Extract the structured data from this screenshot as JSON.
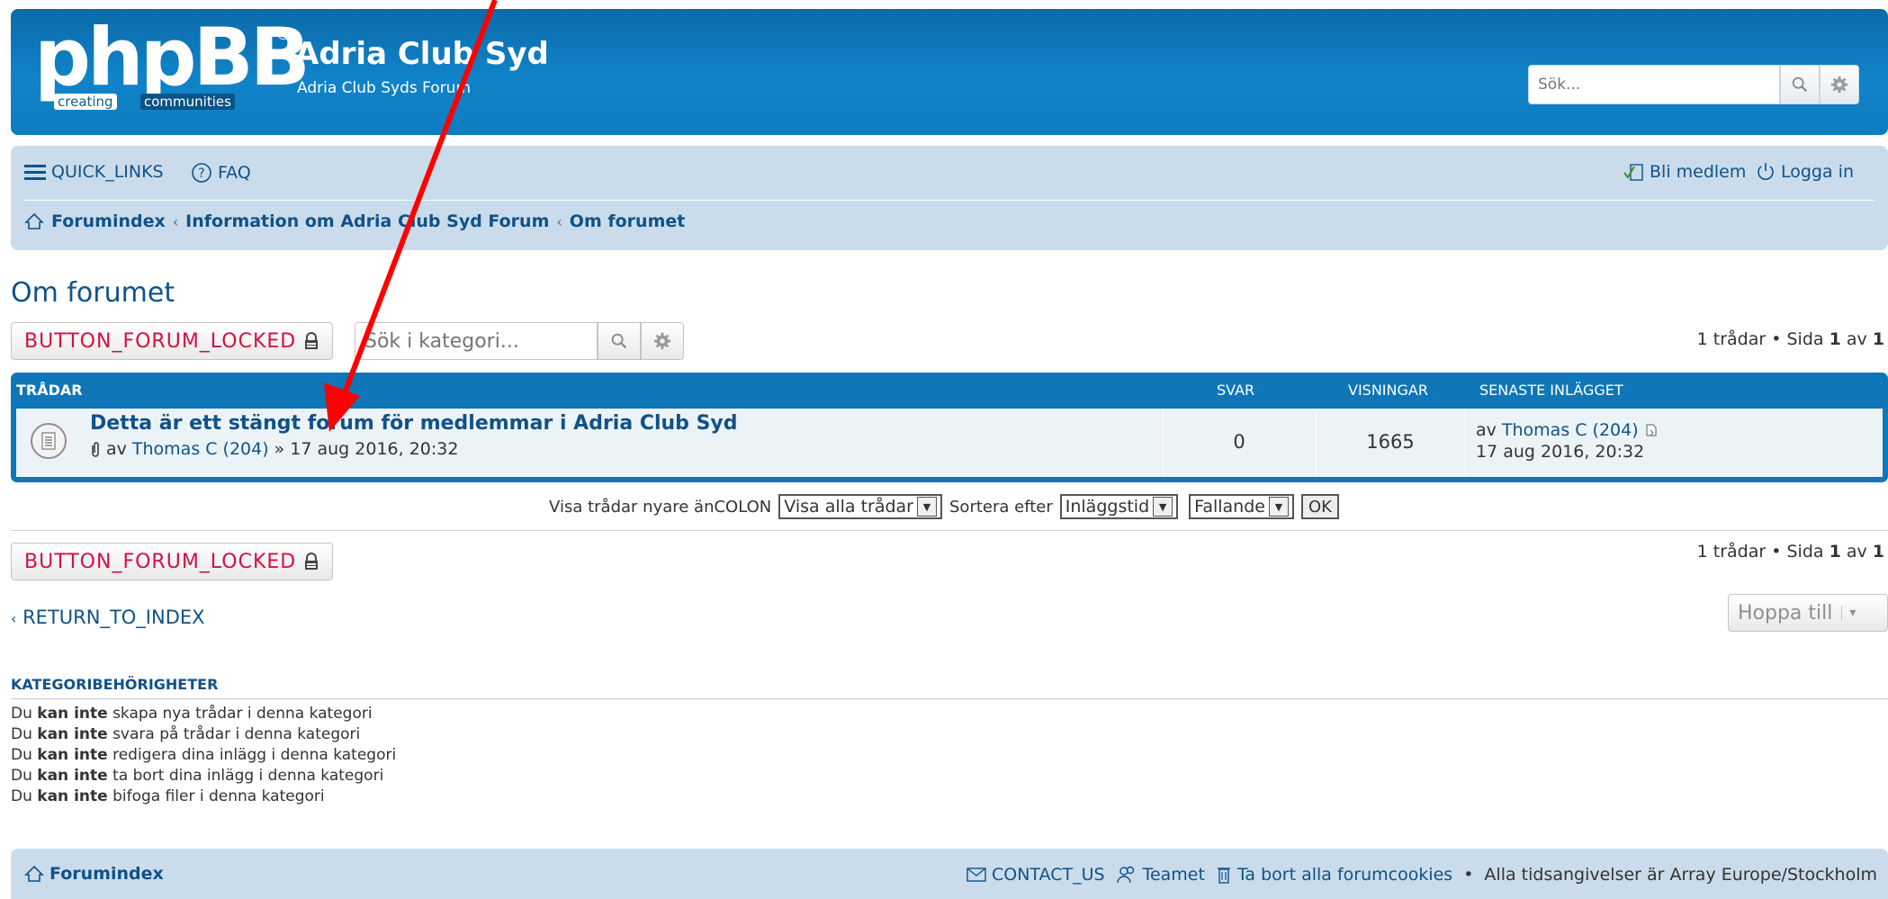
{
  "header": {
    "logo_word": "phpBB",
    "logo_registered": "®",
    "logo_tagline_1": "creating",
    "logo_tagline_2": "communities",
    "site_title": "Adria Club Syd",
    "site_description": "Adria Club Syds Forum",
    "search_placeholder": "Sök..."
  },
  "navbar": {
    "quick_links": "QUICK_LINKS",
    "faq": "FAQ",
    "register": "Bli medlem",
    "login": "Logga in",
    "breadcrumbs": [
      "Forumindex",
      "Information om Adria Club Syd Forum",
      "Om forumet"
    ]
  },
  "forum": {
    "title": "Om forumet",
    "locked_button": "BUTTON_FORUM_LOCKED",
    "category_search_placeholder": "Sök i kategori...",
    "pagination": {
      "prefix": "1 trådar • Sida ",
      "current": "1",
      "middle": " av ",
      "total": "1"
    }
  },
  "topics_table": {
    "headers": {
      "topics": "TRÅDAR",
      "replies": "SVAR",
      "views": "VISNINGAR",
      "last_post": "SENASTE INLÄGGET"
    },
    "rows": [
      {
        "title": "Detta är ett stängt forum för medlemmar i Adria Club Syd",
        "by": "av",
        "author": "Thomas C (204)",
        "date_sep": "»",
        "date": "17 aug 2016, 20:32",
        "replies": "0",
        "views": "1665",
        "last_by": "av",
        "last_author": "Thomas C (204)",
        "last_date": "17 aug 2016, 20:32"
      }
    ]
  },
  "sort": {
    "show_label": "Visa trådar nyare änCOLON",
    "show_value": "Visa alla trådar",
    "sort_label": "Sortera efter",
    "sort_value": "Inläggstid",
    "order_value": "Fallande",
    "ok": "OK"
  },
  "return_to_index": "RETURN_TO_INDEX",
  "jump_to": "Hoppa till",
  "permissions": {
    "title": "KATEGORIBEHÖRIGHETER",
    "prefix": "Du",
    "emphasis": "kan inte",
    "lines": [
      "skapa nya trådar i denna kategori",
      "svara på trådar i denna kategori",
      "redigera dina inlägg i denna kategori",
      "ta bort dina inlägg i denna kategori",
      "bifoga filer i denna kategori"
    ]
  },
  "footer": {
    "index": "Forumindex",
    "contact": "CONTACT_US",
    "team": "Teamet",
    "delete_cookies": "Ta bort alla forumcookies",
    "bullet": "•",
    "timezone": "Alla tidsangivelser är Array Europe/Stockholm"
  },
  "colors": {
    "header_blue": "#0f76b8",
    "nav_bg": "#cadceb",
    "link": "#105289",
    "locked_red": "#d31141",
    "annotation_arrow": "#ff0000"
  }
}
